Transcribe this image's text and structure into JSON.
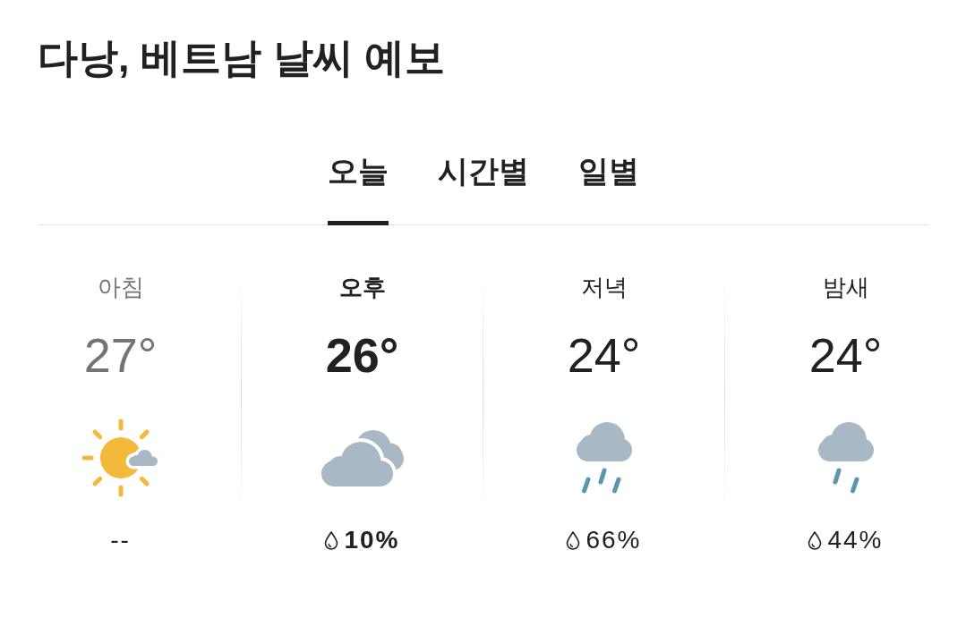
{
  "title": "다낭, 베트남 날씨 예보",
  "tabs": [
    {
      "label": "오늘",
      "selected": true
    },
    {
      "label": "시간별",
      "selected": false
    },
    {
      "label": "일별",
      "selected": false
    }
  ],
  "periods": [
    {
      "label": "아침",
      "temperature": "27°",
      "kind": "mostly-sunny",
      "past": true,
      "current": false,
      "precipitation": {
        "text": "--",
        "drop_icon": false
      }
    },
    {
      "label": "오후",
      "temperature": "26°",
      "kind": "mostly-cloudy",
      "past": false,
      "current": true,
      "precipitation": {
        "text": "10%",
        "drop_icon": true
      }
    },
    {
      "label": "저녁",
      "temperature": "24°",
      "kind": "rain",
      "past": false,
      "current": false,
      "precipitation": {
        "text": "66%",
        "drop_icon": true
      }
    },
    {
      "label": "밤새",
      "temperature": "24°",
      "kind": "light-rain",
      "past": false,
      "current": false,
      "precipitation": {
        "text": "44%",
        "drop_icon": true
      }
    }
  ]
}
